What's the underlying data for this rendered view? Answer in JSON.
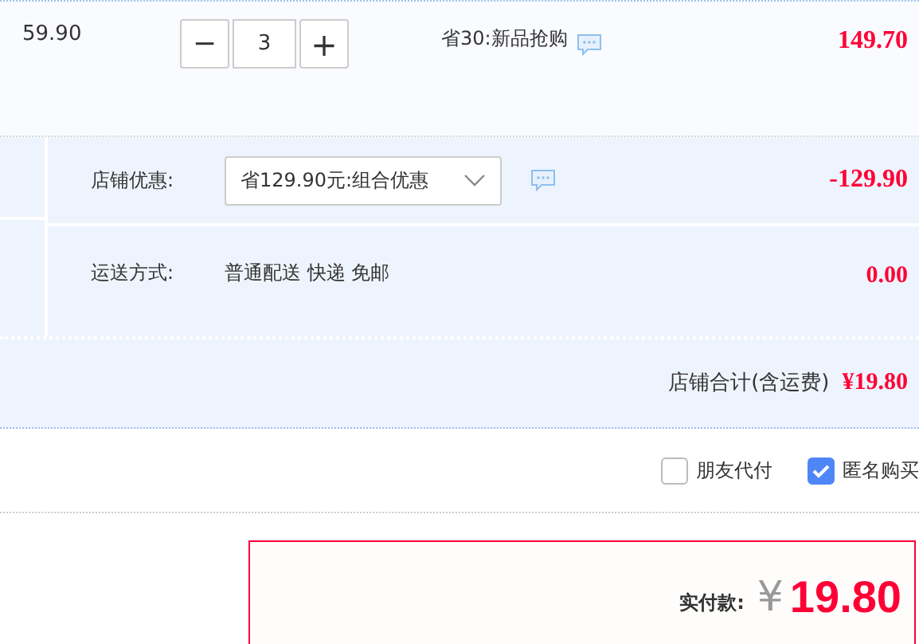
{
  "item": {
    "unit_price": "59.90",
    "quantity": "3",
    "decrement": "−",
    "increment": "+",
    "promo": "省30:新品抢购",
    "subtotal": "149.70"
  },
  "shop": {
    "discount": {
      "label": "店铺优惠:",
      "option": "省129.90元:组合优惠",
      "amount": "-129.90"
    },
    "shipping": {
      "label": "运送方式:",
      "method": "普通配送 快递 免邮",
      "amount": "0.00"
    },
    "total": {
      "label": "店铺合计(含运费)",
      "amount": "¥19.80"
    }
  },
  "options": [
    {
      "label": "朋友代付",
      "checked": false
    },
    {
      "label": "匿名购买",
      "checked": true
    }
  ],
  "payment": {
    "label": "实付款:",
    "currency": "¥",
    "amount": "19.80"
  }
}
